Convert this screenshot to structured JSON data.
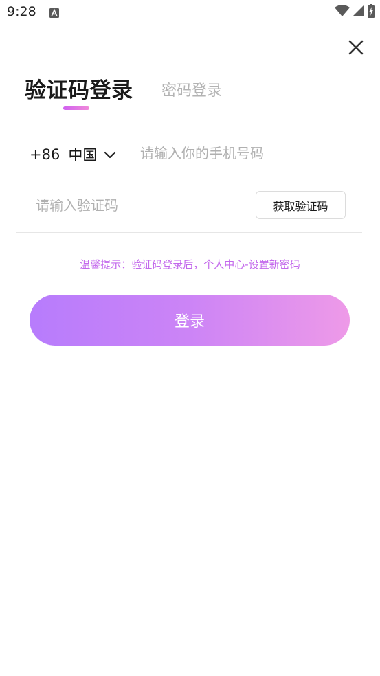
{
  "status_bar": {
    "time": "9:28",
    "notification_icon": "a-box-icon",
    "wifi_icon": "wifi-icon",
    "signal_icon": "cell-signal-icon",
    "battery_icon": "battery-charging-icon"
  },
  "header": {
    "close_icon": "close-icon"
  },
  "tabs": [
    {
      "label": "验证码登录",
      "active": true
    },
    {
      "label": "密码登录",
      "active": false
    }
  ],
  "phone": {
    "country_code": "+86",
    "country_name": "中国",
    "dropdown_icon": "chevron-down-icon",
    "placeholder": "请输入你的手机号码",
    "value": ""
  },
  "verification": {
    "placeholder": "请输入验证码",
    "value": "",
    "get_code_label": "获取验证码"
  },
  "tip": "温馨提示：验证码登录后，个人中心-设置新密码",
  "login_button_label": "登录",
  "colors": {
    "accent_start": "#b77cfc",
    "accent_end": "#ee9ae8",
    "tip_color": "#c368ec",
    "placeholder_color": "#b0b0b0"
  }
}
